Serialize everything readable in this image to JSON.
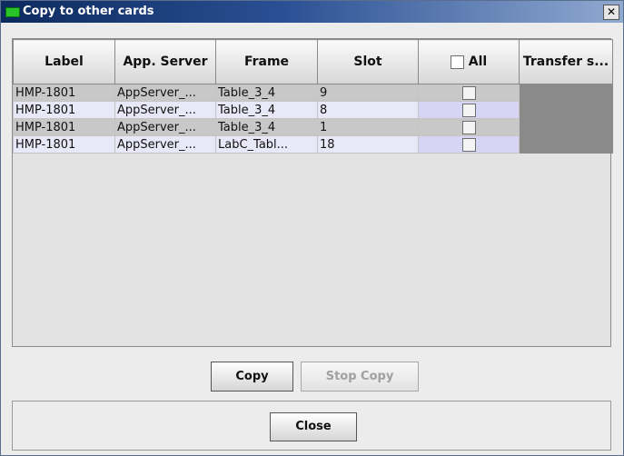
{
  "window": {
    "title": "Copy to other cards",
    "close_glyph": "✕"
  },
  "table": {
    "headers": [
      "Label",
      "App. Server",
      "Frame",
      "Slot",
      "All",
      "Transfer s..."
    ],
    "rows": [
      {
        "label": "HMP-1801",
        "app_server": "AppServer_...",
        "frame": "Table_3_4",
        "slot": "9"
      },
      {
        "label": "HMP-1801",
        "app_server": "AppServer_...",
        "frame": "Table_3_4",
        "slot": "8"
      },
      {
        "label": "HMP-1801",
        "app_server": "AppServer_...",
        "frame": "Table_3_4",
        "slot": "1"
      },
      {
        "label": "HMP-1801",
        "app_server": "AppServer_...",
        "frame": "LabC_Tabl...",
        "slot": "18"
      }
    ]
  },
  "buttons": {
    "copy": "Copy",
    "stop_copy": "Stop Copy",
    "close": "Close"
  },
  "colors": {
    "title_gradient_start": "#0c2a5e",
    "title_icon": "#29c429",
    "transfer_cell": "#8a8a8a"
  },
  "icons": {
    "title_icon": "green-card-icon",
    "close": "close-icon"
  }
}
